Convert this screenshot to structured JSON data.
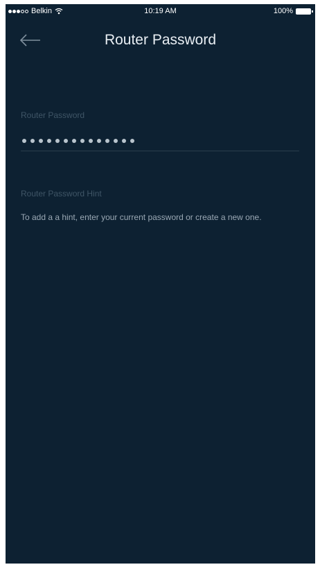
{
  "status_bar": {
    "carrier": "Belkin",
    "time": "10:19 AM",
    "battery": "100%",
    "signal_bars_filled": 3,
    "signal_bars_total": 5
  },
  "header": {
    "title": "Router Password",
    "back_icon": "back-arrow-icon"
  },
  "password_section": {
    "label": "Router Password",
    "masked_dot_count": 14
  },
  "hint_section": {
    "label": "Router Password Hint",
    "description": "To add a a hint, enter your current password or create a new one."
  },
  "colors": {
    "background": "#0d2132",
    "text_primary": "#e8eef3",
    "text_muted": "#3f5566",
    "text_secondary": "#9aa8b4"
  }
}
